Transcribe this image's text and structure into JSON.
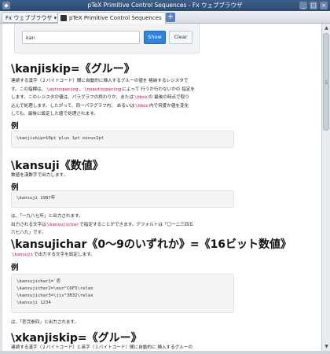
{
  "window": {
    "title": "pTeX Primitive Control Sequences - Fx ウェブブラウザ"
  },
  "tabbar": {
    "menu_label": "Fx ウェブブラウザ ▾",
    "tabs": [
      {
        "label": "pTeX Primitive Control Sequences",
        "active": true
      }
    ],
    "new_tab_symbol": "+"
  },
  "search": {
    "value": "kan",
    "show_label": "Show",
    "clear_label": "Clear"
  },
  "sections": {
    "kanjiskip": {
      "heading": "\\kanjiskip=《グルー》",
      "para": [
        {
          "t": "連続する漢字（２バイトコード）間に自動的に挿入するグルーの値を 格納するレジスタで\nす。この指標は、"
        },
        {
          "c": "\\autospacing"
        },
        {
          "t": "、"
        },
        {
          "c": "\\noautospacing"
        },
        {
          "t": "によって 行うか行わないかの 指定を\nします。このレジスタの値は、パラグラフの終わりか、または"
        },
        {
          "c": "\\hbox"
        },
        {
          "t": "の 最後の時点で取り\n込んで処理します。したがって、同一パラグラフ内、 あるいは"
        },
        {
          "c": "\\hbox"
        },
        {
          "t": "内で何度か値を変化\nしても、最後に設定した値で処理されます。"
        }
      ],
      "example_heading": "例",
      "code": "\\kanjiskip=10pt plus 1pt minus1pt"
    },
    "kansuji": {
      "heading": "\\kansuji《数値》",
      "desc": "数値を漢数字で出力します。",
      "example_heading": "例",
      "code": "\\kansuji 1987年",
      "para": [
        {
          "t": "は、「一九八七年」と出力されます。\n出力される文字は"
        },
        {
          "c": "\\kansujichar"
        },
        {
          "t": "で指定することができます。デフォルトは「〇一二三四五\n六七八九」です。"
        }
      ]
    },
    "kansujichar": {
      "heading": "\\kansujichar《0〜9のいずれか》=《16ビット数値》",
      "para": [
        {
          "c": "\\kansuji"
        },
        {
          "t": "で出力する文字を設定します。"
        }
      ],
      "example_heading": "例",
      "code": "\\kansujichar1=`壱\n\\kansujichar2=\\euc\"C6F5\\relax\n\\kansujichar3=\\jis\"3B32\\relax\n\\kansuji 1234",
      "after": "は、「壱弐参四」と出力されます。"
    },
    "xkanjiskip": {
      "heading": "\\xkanjiskip=《グルー》",
      "para": "連続する漢字（２バイトコード）と英字（１バイトコード）間に自動的に 挿入するグルーの"
    }
  }
}
